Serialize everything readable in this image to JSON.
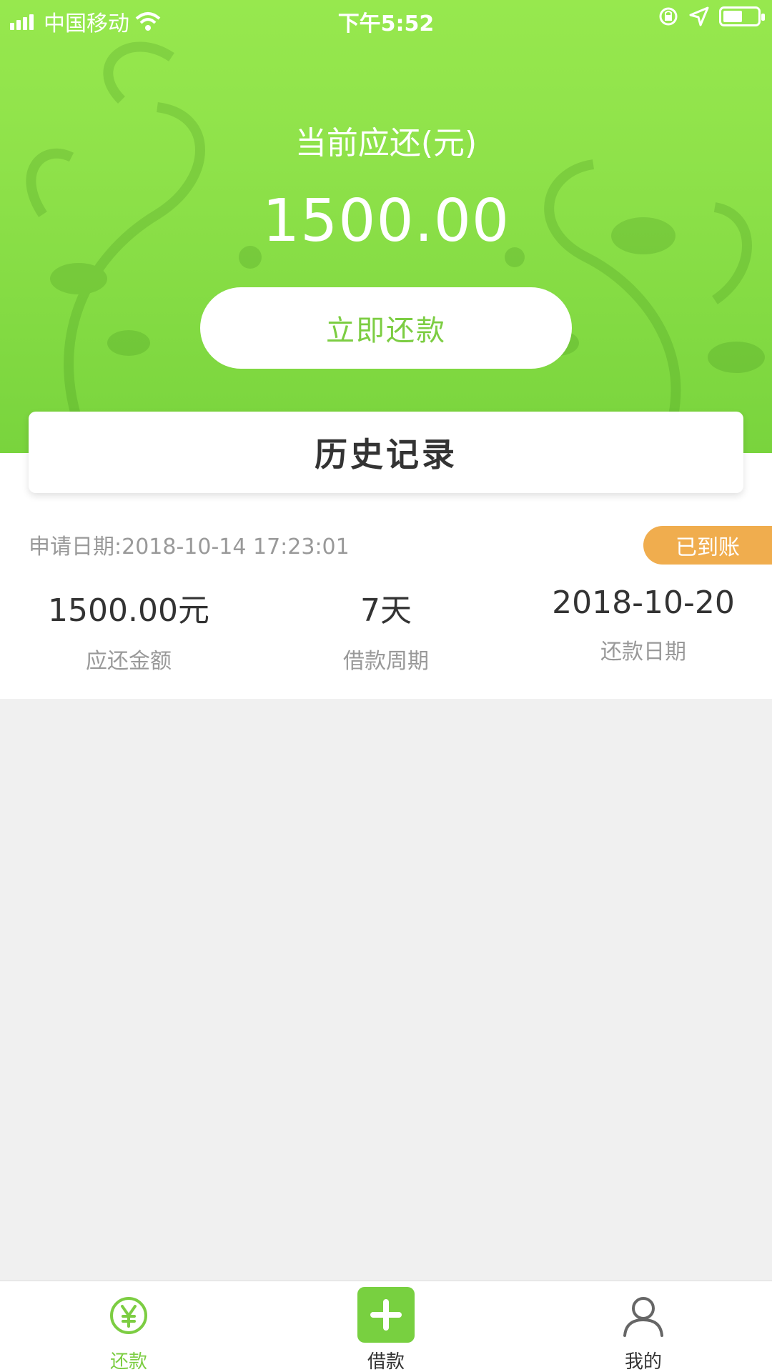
{
  "status_bar": {
    "carrier": "中国移动",
    "time": "下午5:52"
  },
  "hero": {
    "title": "当前应还(元)",
    "amount": "1500.00",
    "repay_button": "立即还款"
  },
  "history": {
    "title": "历史记录"
  },
  "record": {
    "apply_date": "申请日期:2018-10-14 17:23:01",
    "status": "已到账",
    "amount_value": "1500.00元",
    "amount_label": "应还金额",
    "period_value": "7天",
    "period_label": "借款周期",
    "due_value": "2018-10-20",
    "due_label": "还款日期"
  },
  "tabbar": {
    "items": [
      {
        "label": "还款",
        "icon": "yen-circle-icon"
      },
      {
        "label": "借款",
        "icon": "plus-icon"
      },
      {
        "label": "我的",
        "icon": "person-icon"
      }
    ]
  },
  "colors": {
    "brand_green": "#7ccd42",
    "badge_orange": "#f0ad4e"
  }
}
